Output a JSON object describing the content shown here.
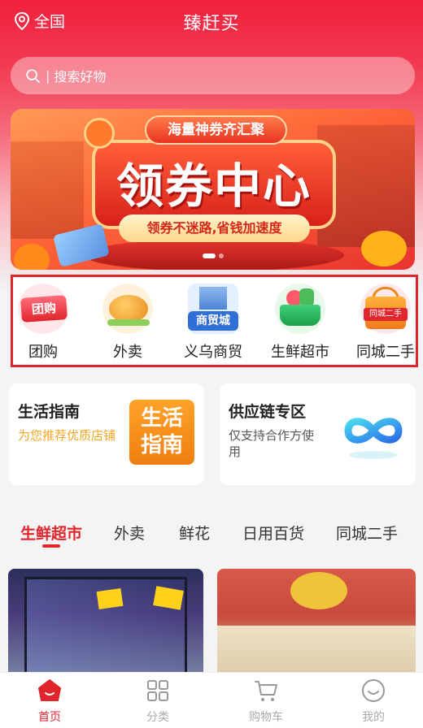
{
  "header": {
    "location": "全国",
    "title": "臻赶买"
  },
  "search": {
    "placeholder": "搜索好物"
  },
  "banner": {
    "tag": "海量神券齐汇聚",
    "headline": "领券中心",
    "subline": "领券不迷路,省钱加速度"
  },
  "categories": [
    {
      "label": "团购",
      "icon_text": "团购"
    },
    {
      "label": "外卖"
    },
    {
      "label": "义乌商贸",
      "icon_text": "商贸城"
    },
    {
      "label": "生鲜超市"
    },
    {
      "label": "同城二手",
      "icon_text": "同城二手"
    }
  ],
  "cards": {
    "guide": {
      "title": "生活指南",
      "desc": "为您推荐优质店铺",
      "badge": "生活\n指南"
    },
    "supply": {
      "title": "供应链专区",
      "desc": "仅支持合作方使用"
    }
  },
  "tabs": [
    {
      "label": "生鲜超市",
      "active": true
    },
    {
      "label": "外卖"
    },
    {
      "label": "鲜花"
    },
    {
      "label": "日用百货"
    },
    {
      "label": "同城二手"
    }
  ],
  "bottom_nav": [
    {
      "label": "首页",
      "icon": "home-icon",
      "active": true
    },
    {
      "label": "分类",
      "icon": "grid-icon"
    },
    {
      "label": "购物车",
      "icon": "cart-icon"
    },
    {
      "label": "我的",
      "icon": "profile-icon"
    }
  ],
  "colors": {
    "brand": "#e0262d",
    "gold": "#f5a623"
  }
}
